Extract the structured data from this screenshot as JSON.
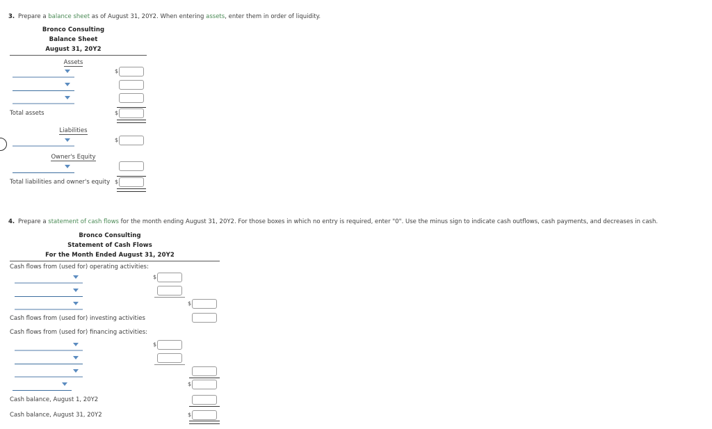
{
  "questions": [
    {
      "number": "3.",
      "prefix": "Prepare a ",
      "term1": "balance sheet",
      "mid": " as of August 31, 20Y2. When entering ",
      "term2": "assets",
      "suffix": ", enter them in order of liquidity."
    },
    {
      "number": "4.",
      "prefix": "Prepare a ",
      "term1": "statement of cash flows",
      "mid": " for the month ending August 31, 20Y2. For those boxes in which no entry is required, enter \"0\". Use the minus sign to indicate cash outflows, cash payments, and decreases in cash.",
      "term2": "",
      "suffix": ""
    }
  ],
  "balance_sheet": {
    "company": "Bronco Consulting",
    "title": "Balance Sheet",
    "date": "August 31, 20Y2",
    "sections": {
      "assets_label": "Assets",
      "liabilities_label": "Liabilities",
      "owners_equity_label": "Owner's Equity"
    },
    "asset_rows": [
      {
        "dropdown_value": "",
        "amount": "",
        "dollar": "$"
      },
      {
        "dropdown_value": "",
        "amount": "",
        "dollar": ""
      },
      {
        "dropdown_value": "",
        "amount": "",
        "dollar": ""
      }
    ],
    "total_assets_label": "Total assets",
    "total_assets_amount": "",
    "total_assets_dollar": "$",
    "liability_rows": [
      {
        "dropdown_value": "",
        "amount": "",
        "dollar": "$"
      }
    ],
    "equity_rows": [
      {
        "dropdown_value": "",
        "amount": "",
        "dollar": ""
      }
    ],
    "total_liab_equity_label": "Total liabilities and owner's equity",
    "total_liab_equity_amount": "",
    "total_liab_equity_dollar": "$"
  },
  "cash_flows": {
    "company": "Bronco Consulting",
    "title": "Statement of Cash Flows",
    "date": "For the Month Ended August 31, 20Y2",
    "operating_label": "Cash flows from (used for) operating activities:",
    "operating_rows": [
      {
        "dropdown_value": "",
        "amount": "",
        "dollar": "$",
        "column": "inner"
      },
      {
        "dropdown_value": "",
        "amount": "",
        "dollar": "",
        "column": "inner"
      },
      {
        "dropdown_value": "",
        "amount": "",
        "dollar": "$",
        "column": "outer"
      }
    ],
    "investing_label": "Cash flows from (used for) investing activities",
    "investing_amount": "",
    "investing_dollar": "",
    "financing_label": "Cash flows from (used for) financing activities:",
    "financing_rows": [
      {
        "dropdown_value": "",
        "amount": "",
        "dollar": "$",
        "column": "inner"
      },
      {
        "dropdown_value": "",
        "amount": "",
        "dollar": "",
        "column": "inner"
      },
      {
        "dropdown_value": "",
        "amount": "",
        "dollar": "",
        "column": "outer"
      },
      {
        "dropdown_value": "",
        "amount": "",
        "dollar": "$",
        "column": "outer"
      }
    ],
    "begin_balance_label": "Cash balance, August 1, 20Y2",
    "begin_balance_amount": "",
    "begin_balance_dollar": "",
    "end_balance_label": "Cash balance, August 31, 20Y2",
    "end_balance_amount": "",
    "end_balance_dollar": "$"
  },
  "icons": {
    "caret": "chevron-down-icon"
  },
  "colors": {
    "term_green": "#4a8a55",
    "dropdown_light": "#a8bdd4",
    "dropdown_dark": "#3c6e9f",
    "caret_blue": "#5b8cc0",
    "rule_dark": "#333333",
    "box_border": "#9a9a9a"
  }
}
